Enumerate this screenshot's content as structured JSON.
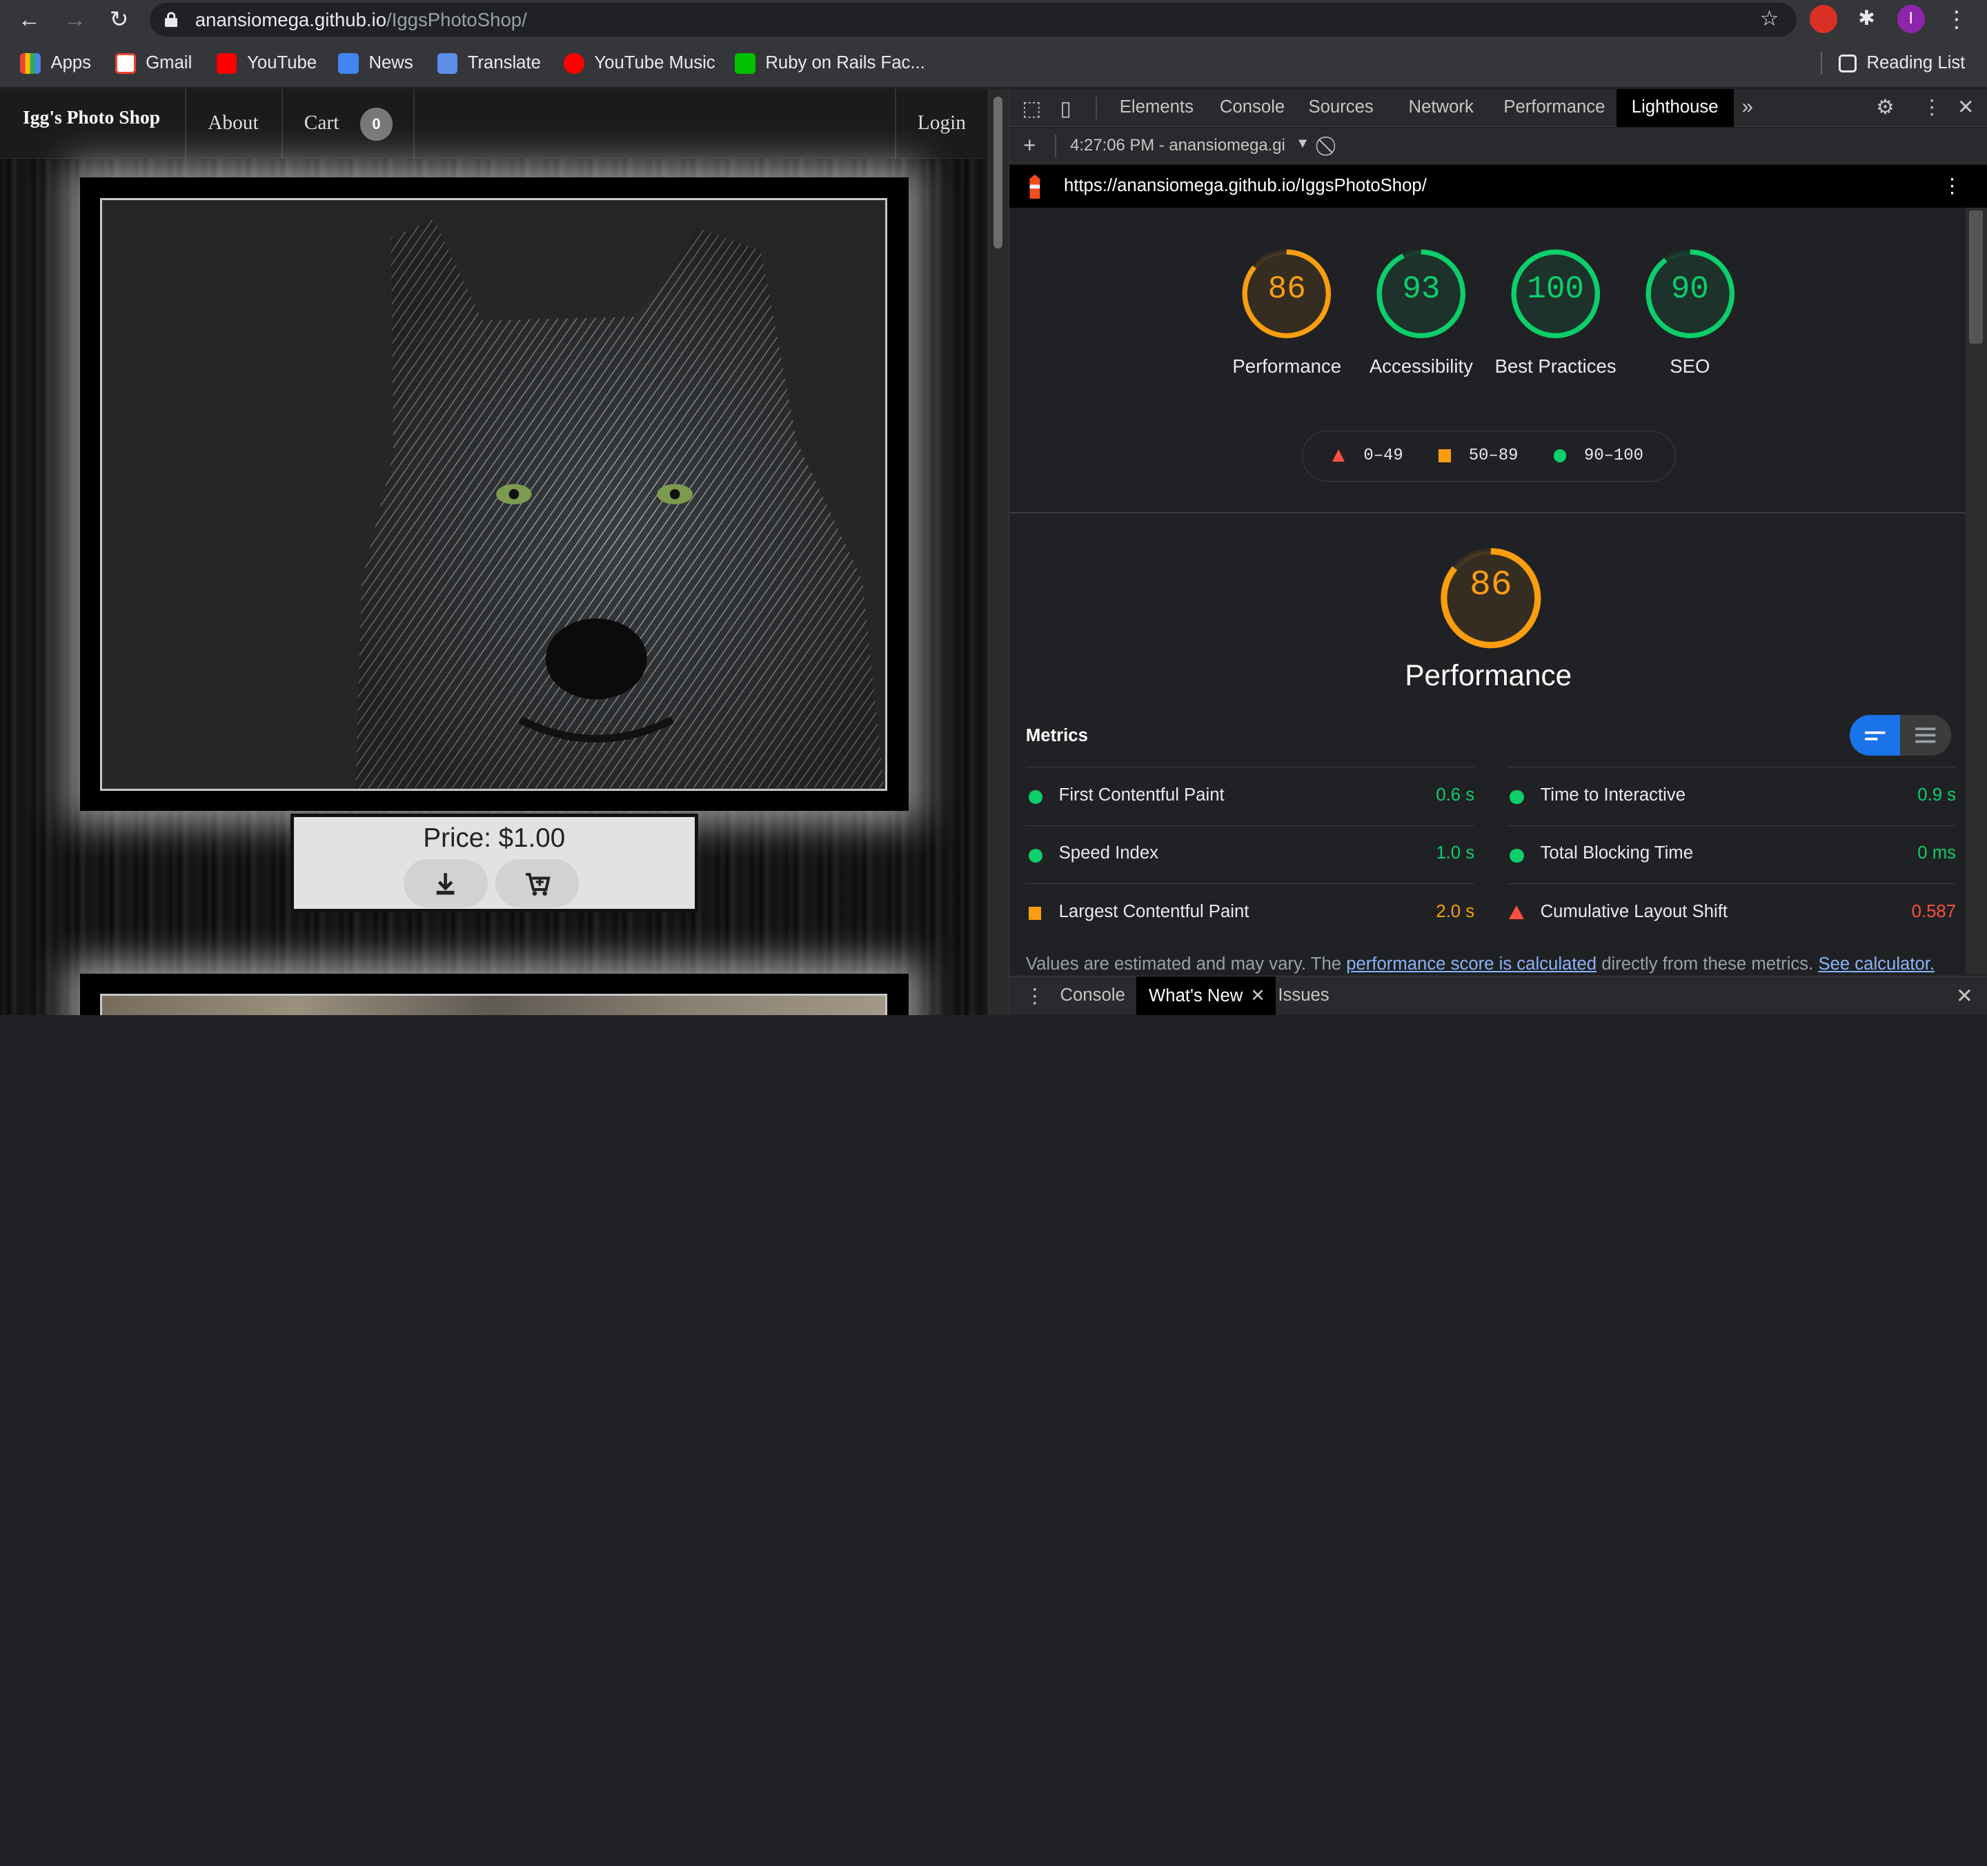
{
  "browser": {
    "url_host": "anansiomega.github.io",
    "url_path": "/IggsPhotoShop/",
    "bookmarks": [
      "Apps",
      "Gmail",
      "YouTube",
      "News",
      "Translate",
      "YouTube Music",
      "Ruby on Rails Fac..."
    ],
    "reading_list": "Reading List",
    "profile_initial": "I"
  },
  "site": {
    "brand": "Igg's Photo Shop",
    "nav": {
      "about": "About",
      "cart": "Cart",
      "cart_count": "0",
      "login": "Login"
    },
    "product": {
      "price": "Price: $1.00"
    }
  },
  "devtools": {
    "tabs": [
      "Elements",
      "Console",
      "Sources",
      "Network",
      "Performance",
      "Lighthouse"
    ],
    "report_selector": "4:27:06 PM - anansiomega.gi",
    "report_url": "https://anansiomega.github.io/IggsPhotoShop/",
    "scores": [
      {
        "label": "Performance",
        "value": 86,
        "color": "#fa9e0f"
      },
      {
        "label": "Accessibility",
        "value": 93,
        "color": "#0cce6b"
      },
      {
        "label": "Best Practices",
        "value": 100,
        "color": "#0cce6b"
      },
      {
        "label": "SEO",
        "value": 90,
        "color": "#0cce6b"
      }
    ],
    "legend": [
      "0–49",
      "50–89",
      "90–100"
    ],
    "category": {
      "title": "Performance",
      "score": 86
    },
    "metrics_heading": "Metrics",
    "metrics": [
      {
        "name": "First Contentful Paint",
        "value": "0.6 s",
        "rating": "pass"
      },
      {
        "name": "Time to Interactive",
        "value": "0.9 s",
        "rating": "pass"
      },
      {
        "name": "Speed Index",
        "value": "1.0 s",
        "rating": "pass"
      },
      {
        "name": "Total Blocking Time",
        "value": "0 ms",
        "rating": "pass"
      },
      {
        "name": "Largest Contentful Paint",
        "value": "2.0 s",
        "rating": "average"
      },
      {
        "name": "Cumulative Layout Shift",
        "value": "0.587",
        "rating": "fail"
      }
    ],
    "note": {
      "pre": "Values are estimated and may vary. The ",
      "link1": "performance score is calculated",
      "mid": " directly from these metrics. ",
      "link2": "See calculator."
    },
    "drawer_tabs": [
      "Console",
      "What's New",
      "Issues"
    ],
    "colors": {
      "pass": "#0cce6b",
      "average": "#fa9e0f",
      "fail": "#ff4e42"
    }
  }
}
